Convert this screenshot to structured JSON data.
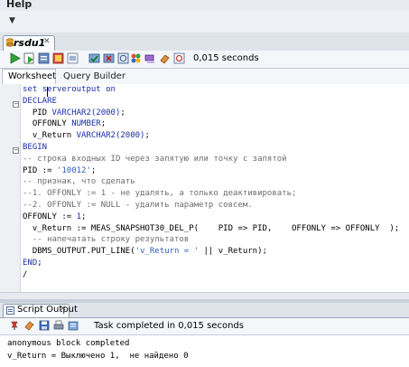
{
  "menu": {
    "help": "Help"
  },
  "document_tab": {
    "title": "rsdu1"
  },
  "toolbar": {
    "timing": "0,015 seconds"
  },
  "subtabs": {
    "worksheet": "Worksheet",
    "query_builder": "Query Builder"
  },
  "editor": {
    "lines": [
      [
        {
          "t": "set ",
          "c": "kw"
        },
        {
          "t": "serveroutput on",
          "c": "kw"
        }
      ],
      [
        {
          "t": "DECLARE",
          "c": "kw"
        }
      ],
      [
        {
          "t": "  PID ",
          "c": ""
        },
        {
          "t": "VARCHAR2(2000)",
          "c": "kw"
        },
        {
          "t": ";",
          "c": ""
        }
      ],
      [
        {
          "t": "  OFFONLY ",
          "c": ""
        },
        {
          "t": "NUMBER",
          "c": "kw"
        },
        {
          "t": ";",
          "c": ""
        }
      ],
      [
        {
          "t": "  v_Return ",
          "c": ""
        },
        {
          "t": "VARCHAR2(2000)",
          "c": "kw"
        },
        {
          "t": ";",
          "c": ""
        }
      ],
      [
        {
          "t": "BEGIN",
          "c": "kw"
        }
      ],
      [
        {
          "t": "-- строка входных ID через запятую или точку с запятой",
          "c": "cmt"
        }
      ],
      [
        {
          "t": "PID := ",
          "c": ""
        },
        {
          "t": "'10012'",
          "c": "str"
        },
        {
          "t": ";",
          "c": ""
        }
      ],
      [
        {
          "t": "-- признак, что сделать",
          "c": "cmt"
        }
      ],
      [
        {
          "t": "--1. OFFONLY := 1 - не удалять, а только деактивировать;",
          "c": "cmt"
        }
      ],
      [
        {
          "t": "--2. OFFONLY := NULL - удалить параметр совсем.",
          "c": "cmt"
        }
      ],
      [
        {
          "t": "OFFONLY := ",
          "c": ""
        },
        {
          "t": "1",
          "c": "kw"
        },
        {
          "t": ";",
          "c": ""
        }
      ],
      [
        {
          "t": "  v_Return := MEAS_SNAPSHOT30_DEL_P(    PID => PID,    OFFONLY => OFFONLY  );",
          "c": ""
        }
      ],
      [
        {
          "t": "  -- напечатать строку результатов",
          "c": "cmt"
        }
      ],
      [
        {
          "t": "  DBMS_OUTPUT.PUT_LINE(",
          "c": ""
        },
        {
          "t": "'v_Return = '",
          "c": "str"
        },
        {
          "t": " || v_Return);",
          "c": ""
        }
      ],
      [
        {
          "t": "END",
          "c": "kw"
        },
        {
          "t": ";",
          "c": ""
        }
      ],
      [
        {
          "t": "/",
          "c": ""
        }
      ]
    ]
  },
  "output_panel": {
    "tab_title": "Script Output",
    "status": "Task completed in 0,015 seconds",
    "lines": [
      "anonymous block completed",
      "v_Return = Выключено 1,  не найдено 0"
    ]
  }
}
